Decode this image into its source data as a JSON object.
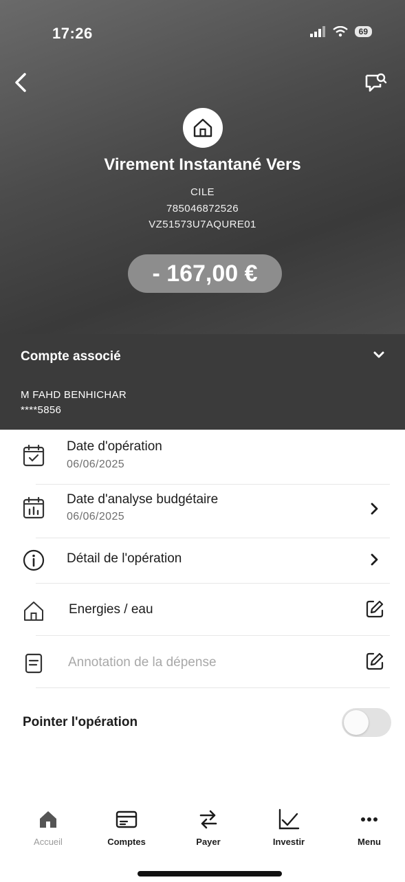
{
  "status_bar": {
    "time": "17:26",
    "battery": "69"
  },
  "operation": {
    "title": "Virement Instantané Vers",
    "beneficiary": "CILE",
    "reference_1": "785046872526",
    "reference_2": "VZ51573U7AQURE01",
    "amount": "- 167,00 €"
  },
  "account": {
    "header": "Compte associé",
    "holder": "M FAHD BENHICHAR",
    "number": "****5856"
  },
  "details": {
    "operation_date_label": "Date d'opération",
    "operation_date": "06/06/2025",
    "budget_date_label": "Date d'analyse budgétaire",
    "budget_date": "06/06/2025",
    "operation_detail_label": "Détail de l'opération",
    "category_label": "Energies / eau",
    "annotation_placeholder": "Annotation de la dépense"
  },
  "pointer": {
    "label": "Pointer l'opération",
    "checked": false
  },
  "tabs": [
    {
      "label": "Accueil",
      "icon": "home-icon",
      "active": true
    },
    {
      "label": "Comptes",
      "icon": "card-icon",
      "active": false
    },
    {
      "label": "Payer",
      "icon": "transfer-arrows-icon",
      "active": false
    },
    {
      "label": "Investir",
      "icon": "chart-line-icon",
      "active": false
    },
    {
      "label": "Menu",
      "icon": "more-dots-icon",
      "active": false
    }
  ]
}
